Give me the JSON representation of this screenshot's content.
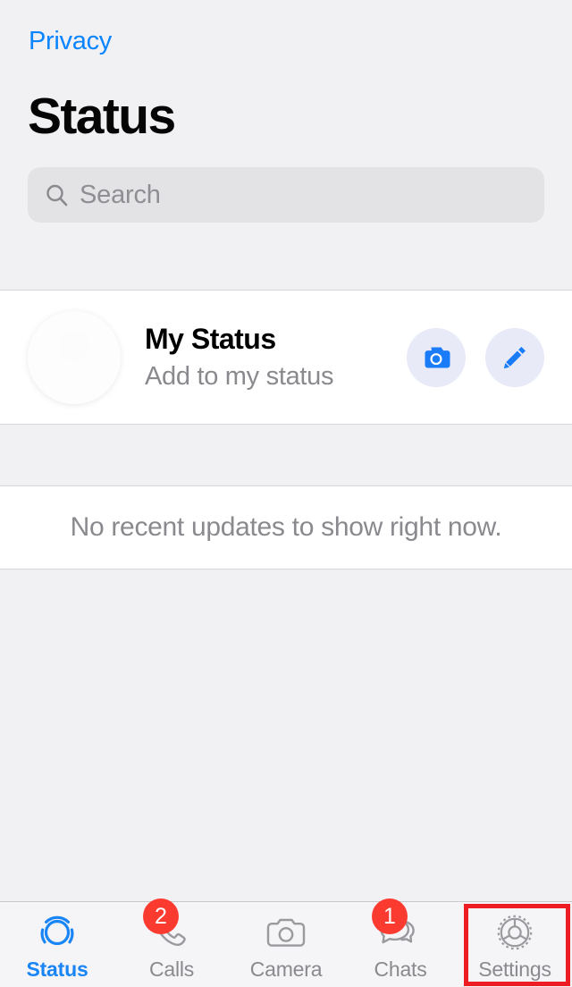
{
  "header": {
    "back_label": "Privacy",
    "title": "Status"
  },
  "search": {
    "placeholder": "Search",
    "value": "",
    "icon": "search-icon"
  },
  "my_status": {
    "title": "My Status",
    "subtitle": "Add to my status",
    "avatar_icon": "person-avatar-placeholder",
    "actions": [
      {
        "name": "camera-button",
        "icon": "camera-icon"
      },
      {
        "name": "compose-button",
        "icon": "pencil-icon"
      }
    ]
  },
  "empty_state": {
    "message": "No recent updates to show right now."
  },
  "tab_bar": {
    "items": [
      {
        "label": "Status",
        "icon": "status-ring-icon",
        "badge": "",
        "active": true
      },
      {
        "label": "Calls",
        "icon": "phone-icon",
        "badge": "2",
        "active": false
      },
      {
        "label": "Camera",
        "icon": "camera-outline-icon",
        "badge": "",
        "active": false
      },
      {
        "label": "Chats",
        "icon": "chat-bubbles-icon",
        "badge": "1",
        "active": false
      },
      {
        "label": "Settings",
        "icon": "gear-icon",
        "badge": "",
        "active": false
      }
    ]
  },
  "annotation": {
    "target": "settings-tab",
    "color": "#ee1c23"
  },
  "colors": {
    "accent_blue": "#0a84ff",
    "tab_active": "#1a85f5",
    "badge_red": "#fb3b30",
    "background": "#f1f1f4",
    "card": "#ffffff",
    "secondary_text": "#8a8a8e",
    "search_field": "#e3e3e6",
    "action_button_bg": "#e9eaf7",
    "highlight": "#ee1c23"
  }
}
